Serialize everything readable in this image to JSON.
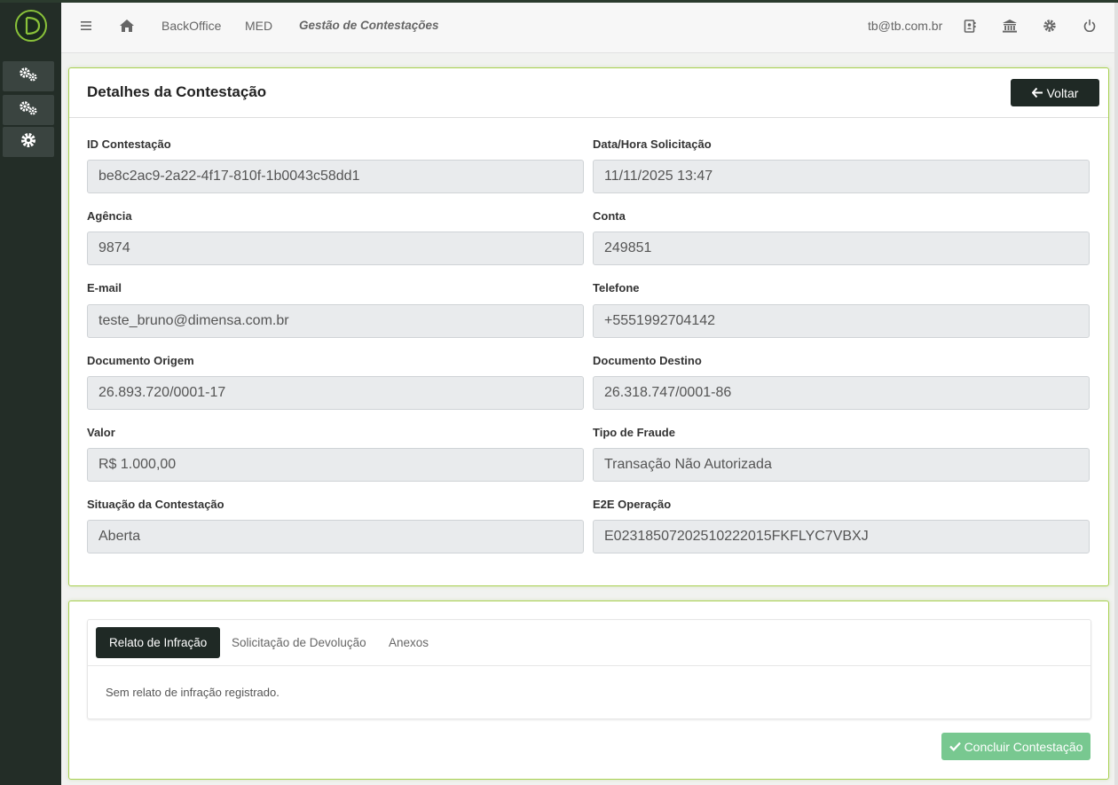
{
  "colors": {
    "sidebar": "#232d27",
    "accent": "#a8d050",
    "dark_button": "#1f2925",
    "success_button": "#78c890"
  },
  "sidebar": {
    "logo_icon": "dimensa-logo-icon",
    "items": [
      {
        "icon": "cogs-icon"
      },
      {
        "icon": "cogs-icon"
      },
      {
        "icon": "gear-icon"
      }
    ]
  },
  "topbar": {
    "menu_icon": "hamburger-icon",
    "home_icon": "home-icon",
    "breadcrumb": [
      "BackOffice",
      "MED",
      "Gestão de Contestações"
    ],
    "user_email": "tb@tb.com.br",
    "icons": [
      "contact-book-icon",
      "bank-icon",
      "gear-icon",
      "power-icon"
    ]
  },
  "details": {
    "title": "Detalhes da Contestação",
    "back_button": "Voltar",
    "fields": [
      {
        "label": "ID Contestação",
        "value": "be8c2ac9-2a22-4f17-810f-1b0043c58dd1"
      },
      {
        "label": "Data/Hora Solicitação",
        "value": "11/11/2025 13:47"
      },
      {
        "label": "Agência",
        "value": "9874"
      },
      {
        "label": "Conta",
        "value": "249851"
      },
      {
        "label": "E-mail",
        "value": "teste_bruno@dimensa.com.br"
      },
      {
        "label": "Telefone",
        "value": "+5551992704142"
      },
      {
        "label": "Documento Origem",
        "value": "26.893.720/0001-17"
      },
      {
        "label": "Documento Destino",
        "value": "26.318.747/0001-86"
      },
      {
        "label": "Valor",
        "value": "R$ 1.000,00"
      },
      {
        "label": "Tipo de Fraude",
        "value": "Transação Não Autorizada"
      },
      {
        "label": "Situação da Contestação",
        "value": "Aberta"
      },
      {
        "label": "E2E Operação",
        "value": "E0231850720251022201​5FKFLYC7VBXJ"
      }
    ]
  },
  "tabs": {
    "items": [
      "Relato de Infração",
      "Solicitação de Devolução",
      "Anexos"
    ],
    "active": 0,
    "content": "Sem relato de infração registrado."
  },
  "actions": {
    "conclude_button": "Concluir Contestação"
  }
}
